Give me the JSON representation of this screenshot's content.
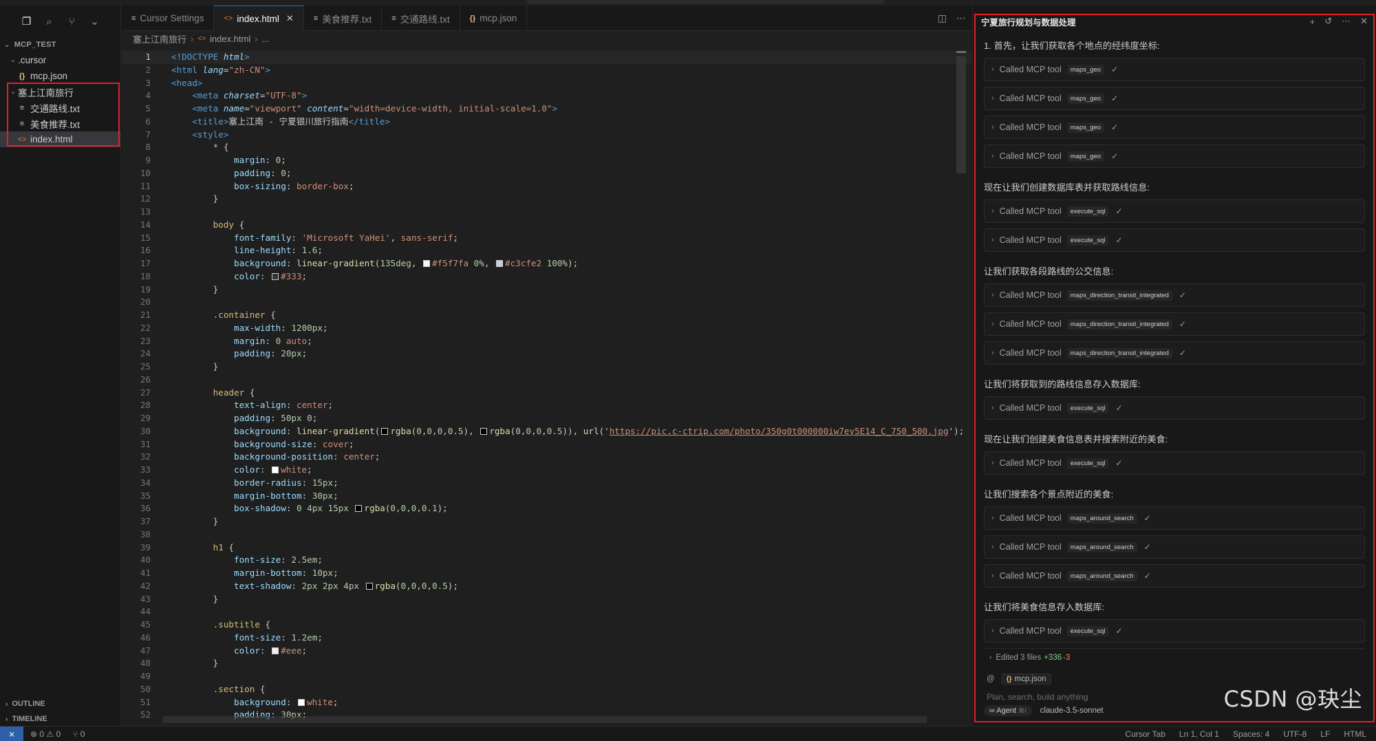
{
  "sidebar": {
    "icons": [
      "files-icon",
      "search-icon",
      "source-control-icon",
      "chevron-down-icon"
    ],
    "explorer_title": "MCP_TEST",
    "tree": [
      {
        "label": ".cursor",
        "type": "folder",
        "indent": 1
      },
      {
        "label": "mcp.json",
        "type": "json",
        "indent": 2
      },
      {
        "label": "塞上江南旅行",
        "type": "folder",
        "indent": 1
      },
      {
        "label": "交通路线.txt",
        "type": "txt",
        "indent": 2
      },
      {
        "label": "美食推荐.txt",
        "type": "txt",
        "indent": 2
      },
      {
        "label": "index.html",
        "type": "html",
        "indent": 2
      }
    ],
    "outline_label": "OUTLINE",
    "timeline_label": "TIMELINE"
  },
  "tabs": [
    {
      "label": "Cursor Settings",
      "icon": "≡",
      "active": false
    },
    {
      "label": "index.html",
      "icon": "<>",
      "active": true
    },
    {
      "label": "美食推荐.txt",
      "icon": "≡",
      "active": false
    },
    {
      "label": "交通路线.txt",
      "icon": "≡",
      "active": false
    },
    {
      "label": "mcp.json",
      "icon": "{}",
      "active": false
    }
  ],
  "breadcrumb": [
    "塞上江南旅行",
    "index.html",
    "..."
  ],
  "code_lines": [
    [
      [
        "c-tag",
        "<!DOCTYPE "
      ],
      [
        "c-att",
        "html"
      ],
      [
        "c-tag",
        ">"
      ]
    ],
    [
      [
        "c-tag",
        "<html "
      ],
      [
        "c-att",
        "lang"
      ],
      [
        "c-punct",
        "="
      ],
      [
        "c-str",
        "\"zh-CN\""
      ],
      [
        "c-tag",
        ">"
      ]
    ],
    [
      [
        "c-tag",
        "<head>"
      ]
    ],
    [
      [
        "c-punct",
        "    "
      ],
      [
        "c-tag",
        "<meta "
      ],
      [
        "c-att",
        "charset"
      ],
      [
        "c-punct",
        "="
      ],
      [
        "c-str",
        "\"UTF-8\""
      ],
      [
        "c-tag",
        ">"
      ]
    ],
    [
      [
        "c-punct",
        "    "
      ],
      [
        "c-tag",
        "<meta "
      ],
      [
        "c-att",
        "name"
      ],
      [
        "c-punct",
        "="
      ],
      [
        "c-str",
        "\"viewport\" "
      ],
      [
        "c-att",
        "content"
      ],
      [
        "c-punct",
        "="
      ],
      [
        "c-str",
        "\"width=device-width, initial-scale=1.0\""
      ],
      [
        "c-tag",
        ">"
      ]
    ],
    [
      [
        "c-punct",
        "    "
      ],
      [
        "c-tag",
        "<title>"
      ],
      [
        "c-punct",
        "塞上江南 - 宁夏银川旅行指南"
      ],
      [
        "c-tag",
        "</title>"
      ]
    ],
    [
      [
        "c-punct",
        "    "
      ],
      [
        "c-tag",
        "<style>"
      ]
    ],
    [
      [
        "c-punct",
        "        "
      ],
      [
        "c-sel",
        "* "
      ],
      [
        "c-punct",
        "{"
      ]
    ],
    [
      [
        "c-punct",
        "            "
      ],
      [
        "c-prop",
        "margin"
      ],
      [
        "c-punct",
        ": "
      ],
      [
        "c-num",
        "0"
      ],
      [
        "c-punct",
        ";"
      ]
    ],
    [
      [
        "c-punct",
        "            "
      ],
      [
        "c-prop",
        "padding"
      ],
      [
        "c-punct",
        ": "
      ],
      [
        "c-num",
        "0"
      ],
      [
        "c-punct",
        ";"
      ]
    ],
    [
      [
        "c-punct",
        "            "
      ],
      [
        "c-prop",
        "box-sizing"
      ],
      [
        "c-punct",
        ": "
      ],
      [
        "c-str",
        "border-box"
      ],
      [
        "c-punct",
        ";"
      ]
    ],
    [
      [
        "c-punct",
        "        }"
      ]
    ],
    [
      [
        "c-punct",
        ""
      ]
    ],
    [
      [
        "c-punct",
        "        "
      ],
      [
        "c-sel",
        "body "
      ],
      [
        "c-punct",
        "{"
      ]
    ],
    [
      [
        "c-punct",
        "            "
      ],
      [
        "c-prop",
        "font-family"
      ],
      [
        "c-punct",
        ": "
      ],
      [
        "c-str",
        "'Microsoft YaHei'"
      ],
      [
        "c-punct",
        ", "
      ],
      [
        "c-str",
        "sans-serif"
      ],
      [
        "c-punct",
        ";"
      ]
    ],
    [
      [
        "c-punct",
        "            "
      ],
      [
        "c-prop",
        "line-height"
      ],
      [
        "c-punct",
        ": "
      ],
      [
        "c-num",
        "1.6"
      ],
      [
        "c-punct",
        ";"
      ]
    ],
    [
      [
        "c-punct",
        "            "
      ],
      [
        "c-prop",
        "background"
      ],
      [
        "c-punct",
        ": "
      ],
      [
        "c-fn",
        "linear-gradient"
      ],
      [
        "c-punct",
        "("
      ],
      [
        "c-num",
        "135deg"
      ],
      [
        "c-punct",
        ", "
      ],
      [
        "swatch",
        "#f5f7fa"
      ],
      [
        "c-str",
        "#f5f7fa "
      ],
      [
        "c-num",
        "0%"
      ],
      [
        "c-punct",
        ", "
      ],
      [
        "swatch",
        "#c3cfe2"
      ],
      [
        "c-str",
        "#c3cfe2 "
      ],
      [
        "c-num",
        "100%"
      ],
      [
        "c-punct",
        ");"
      ]
    ],
    [
      [
        "c-punct",
        "            "
      ],
      [
        "c-prop",
        "color"
      ],
      [
        "c-punct",
        ": "
      ],
      [
        "swatch",
        "#333333"
      ],
      [
        "c-str",
        "#333"
      ],
      [
        "c-punct",
        ";"
      ]
    ],
    [
      [
        "c-punct",
        "        }"
      ]
    ],
    [
      [
        "c-punct",
        ""
      ]
    ],
    [
      [
        "c-punct",
        "        "
      ],
      [
        "c-sel",
        ".container "
      ],
      [
        "c-punct",
        "{"
      ]
    ],
    [
      [
        "c-punct",
        "            "
      ],
      [
        "c-prop",
        "max-width"
      ],
      [
        "c-punct",
        ": "
      ],
      [
        "c-num",
        "1200px"
      ],
      [
        "c-punct",
        ";"
      ]
    ],
    [
      [
        "c-punct",
        "            "
      ],
      [
        "c-prop",
        "margin"
      ],
      [
        "c-punct",
        ": "
      ],
      [
        "c-num",
        "0 "
      ],
      [
        "c-str",
        "auto"
      ],
      [
        "c-punct",
        ";"
      ]
    ],
    [
      [
        "c-punct",
        "            "
      ],
      [
        "c-prop",
        "padding"
      ],
      [
        "c-punct",
        ": "
      ],
      [
        "c-num",
        "20px"
      ],
      [
        "c-punct",
        ";"
      ]
    ],
    [
      [
        "c-punct",
        "        }"
      ]
    ],
    [
      [
        "c-punct",
        ""
      ]
    ],
    [
      [
        "c-punct",
        "        "
      ],
      [
        "c-sel",
        "header "
      ],
      [
        "c-punct",
        "{"
      ]
    ],
    [
      [
        "c-punct",
        "            "
      ],
      [
        "c-prop",
        "text-align"
      ],
      [
        "c-punct",
        ": "
      ],
      [
        "c-str",
        "center"
      ],
      [
        "c-punct",
        ";"
      ]
    ],
    [
      [
        "c-punct",
        "            "
      ],
      [
        "c-prop",
        "padding"
      ],
      [
        "c-punct",
        ": "
      ],
      [
        "c-num",
        "50px 0"
      ],
      [
        "c-punct",
        ";"
      ]
    ],
    [
      [
        "c-punct",
        "            "
      ],
      [
        "c-prop",
        "background"
      ],
      [
        "c-punct",
        ": "
      ],
      [
        "c-fn",
        "linear-gradient"
      ],
      [
        "c-punct",
        "("
      ],
      [
        "swatch",
        "#000000"
      ],
      [
        "c-fn",
        "rgba"
      ],
      [
        "c-punct",
        "("
      ],
      [
        "c-num",
        "0,0,0,0.5"
      ],
      [
        "c-punct",
        "), "
      ],
      [
        "swatch",
        "#000000"
      ],
      [
        "c-fn",
        "rgba"
      ],
      [
        "c-punct",
        "("
      ],
      [
        "c-num",
        "0,0,0,0.5"
      ],
      [
        "c-punct",
        ")), "
      ],
      [
        "c-fn",
        "url"
      ],
      [
        "c-punct",
        "('"
      ],
      [
        "c-url",
        "https://pic.c-ctrip.com/photo/350g0t000000iw7ey5E14_C_750_500.jpg"
      ],
      [
        "c-punct",
        "');"
      ]
    ],
    [
      [
        "c-punct",
        "            "
      ],
      [
        "c-prop",
        "background-size"
      ],
      [
        "c-punct",
        ": "
      ],
      [
        "c-str",
        "cover"
      ],
      [
        "c-punct",
        ";"
      ]
    ],
    [
      [
        "c-punct",
        "            "
      ],
      [
        "c-prop",
        "background-position"
      ],
      [
        "c-punct",
        ": "
      ],
      [
        "c-str",
        "center"
      ],
      [
        "c-punct",
        ";"
      ]
    ],
    [
      [
        "c-punct",
        "            "
      ],
      [
        "c-prop",
        "color"
      ],
      [
        "c-punct",
        ": "
      ],
      [
        "swatch",
        "#ffffff"
      ],
      [
        "c-str",
        "white"
      ],
      [
        "c-punct",
        ";"
      ]
    ],
    [
      [
        "c-punct",
        "            "
      ],
      [
        "c-prop",
        "border-radius"
      ],
      [
        "c-punct",
        ": "
      ],
      [
        "c-num",
        "15px"
      ],
      [
        "c-punct",
        ";"
      ]
    ],
    [
      [
        "c-punct",
        "            "
      ],
      [
        "c-prop",
        "margin-bottom"
      ],
      [
        "c-punct",
        ": "
      ],
      [
        "c-num",
        "30px"
      ],
      [
        "c-punct",
        ";"
      ]
    ],
    [
      [
        "c-punct",
        "            "
      ],
      [
        "c-prop",
        "box-shadow"
      ],
      [
        "c-punct",
        ": "
      ],
      [
        "c-num",
        "0 4px 15px "
      ],
      [
        "swatch",
        "#000000"
      ],
      [
        "c-fn",
        "rgba"
      ],
      [
        "c-punct",
        "("
      ],
      [
        "c-num",
        "0,0,0,0.1"
      ],
      [
        "c-punct",
        ");"
      ]
    ],
    [
      [
        "c-punct",
        "        }"
      ]
    ],
    [
      [
        "c-punct",
        ""
      ]
    ],
    [
      [
        "c-punct",
        "        "
      ],
      [
        "c-sel",
        "h1 "
      ],
      [
        "c-punct",
        "{"
      ]
    ],
    [
      [
        "c-punct",
        "            "
      ],
      [
        "c-prop",
        "font-size"
      ],
      [
        "c-punct",
        ": "
      ],
      [
        "c-num",
        "2.5em"
      ],
      [
        "c-punct",
        ";"
      ]
    ],
    [
      [
        "c-punct",
        "            "
      ],
      [
        "c-prop",
        "margin-bottom"
      ],
      [
        "c-punct",
        ": "
      ],
      [
        "c-num",
        "10px"
      ],
      [
        "c-punct",
        ";"
      ]
    ],
    [
      [
        "c-punct",
        "            "
      ],
      [
        "c-prop",
        "text-shadow"
      ],
      [
        "c-punct",
        ": "
      ],
      [
        "c-num",
        "2px 2px 4px "
      ],
      [
        "swatch",
        "#000000"
      ],
      [
        "c-fn",
        "rgba"
      ],
      [
        "c-punct",
        "("
      ],
      [
        "c-num",
        "0,0,0,0.5"
      ],
      [
        "c-punct",
        ");"
      ]
    ],
    [
      [
        "c-punct",
        "        }"
      ]
    ],
    [
      [
        "c-punct",
        ""
      ]
    ],
    [
      [
        "c-punct",
        "        "
      ],
      [
        "c-sel",
        ".subtitle "
      ],
      [
        "c-punct",
        "{"
      ]
    ],
    [
      [
        "c-punct",
        "            "
      ],
      [
        "c-prop",
        "font-size"
      ],
      [
        "c-punct",
        ": "
      ],
      [
        "c-num",
        "1.2em"
      ],
      [
        "c-punct",
        ";"
      ]
    ],
    [
      [
        "c-punct",
        "            "
      ],
      [
        "c-prop",
        "color"
      ],
      [
        "c-punct",
        ": "
      ],
      [
        "swatch",
        "#eeeeee"
      ],
      [
        "c-str",
        "#eee"
      ],
      [
        "c-punct",
        ";"
      ]
    ],
    [
      [
        "c-punct",
        "        }"
      ]
    ],
    [
      [
        "c-punct",
        ""
      ]
    ],
    [
      [
        "c-punct",
        "        "
      ],
      [
        "c-sel",
        ".section "
      ],
      [
        "c-punct",
        "{"
      ]
    ],
    [
      [
        "c-punct",
        "            "
      ],
      [
        "c-prop",
        "background"
      ],
      [
        "c-punct",
        ": "
      ],
      [
        "swatch",
        "#ffffff"
      ],
      [
        "c-str",
        "white"
      ],
      [
        "c-punct",
        ";"
      ]
    ],
    [
      [
        "c-punct",
        "            "
      ],
      [
        "c-prop",
        "padding"
      ],
      [
        "c-punct",
        ": "
      ],
      [
        "c-num",
        "30px"
      ],
      [
        "c-punct",
        ";"
      ]
    ]
  ],
  "chat": {
    "title": "宁夏旅行规划与数据处理",
    "header_actions": [
      "plus-icon",
      "history-icon",
      "more-icon",
      "close-icon"
    ],
    "called_label": "Called MCP tool",
    "messages": [
      {
        "kind": "text",
        "text": "1. 首先，让我们获取各个地点的经纬度坐标:"
      },
      {
        "kind": "tool",
        "tool": "maps_geo"
      },
      {
        "kind": "tool",
        "tool": "maps_geo"
      },
      {
        "kind": "tool",
        "tool": "maps_geo"
      },
      {
        "kind": "tool",
        "tool": "maps_geo"
      },
      {
        "kind": "text",
        "text": "现在让我们创建数据库表并获取路线信息:"
      },
      {
        "kind": "tool",
        "tool": "execute_sql"
      },
      {
        "kind": "tool",
        "tool": "execute_sql"
      },
      {
        "kind": "text",
        "text": "让我们获取各段路线的公交信息:"
      },
      {
        "kind": "tool",
        "tool": "maps_direction_transit_integrated"
      },
      {
        "kind": "tool",
        "tool": "maps_direction_transit_integrated"
      },
      {
        "kind": "tool",
        "tool": "maps_direction_transit_integrated"
      },
      {
        "kind": "text",
        "text": "让我们将获取到的路线信息存入数据库:"
      },
      {
        "kind": "tool",
        "tool": "execute_sql"
      },
      {
        "kind": "text",
        "text": "现在让我们创建美食信息表并搜索附近的美食:"
      },
      {
        "kind": "tool",
        "tool": "execute_sql"
      },
      {
        "kind": "text",
        "text": "让我们搜索各个景点附近的美食:"
      },
      {
        "kind": "tool",
        "tool": "maps_around_search"
      },
      {
        "kind": "tool",
        "tool": "maps_around_search"
      },
      {
        "kind": "tool",
        "tool": "maps_around_search"
      },
      {
        "kind": "text",
        "text": "让我们将美食信息存入数据库:"
      },
      {
        "kind": "tool",
        "tool": "execute_sql"
      }
    ],
    "edited_label": "Edited 3 files",
    "edited_add": "+336",
    "edited_del": "-3",
    "context_at": "@",
    "context_file": "mcp.json",
    "input_placeholder": "Plan, search, build anything",
    "agent_label": "Agent",
    "agent_shortcut": "⌘I",
    "model": "claude-3.5-sonnet"
  },
  "watermark": "CSDN @玦尘",
  "statusbar": {
    "errors": "⊗ 0 ⚠ 0",
    "ports": "⑂ 0",
    "right": [
      "Cursor Tab",
      "Ln 1, Col 1",
      "Spaces: 4",
      "UTF-8",
      "LF",
      "HTML"
    ]
  }
}
